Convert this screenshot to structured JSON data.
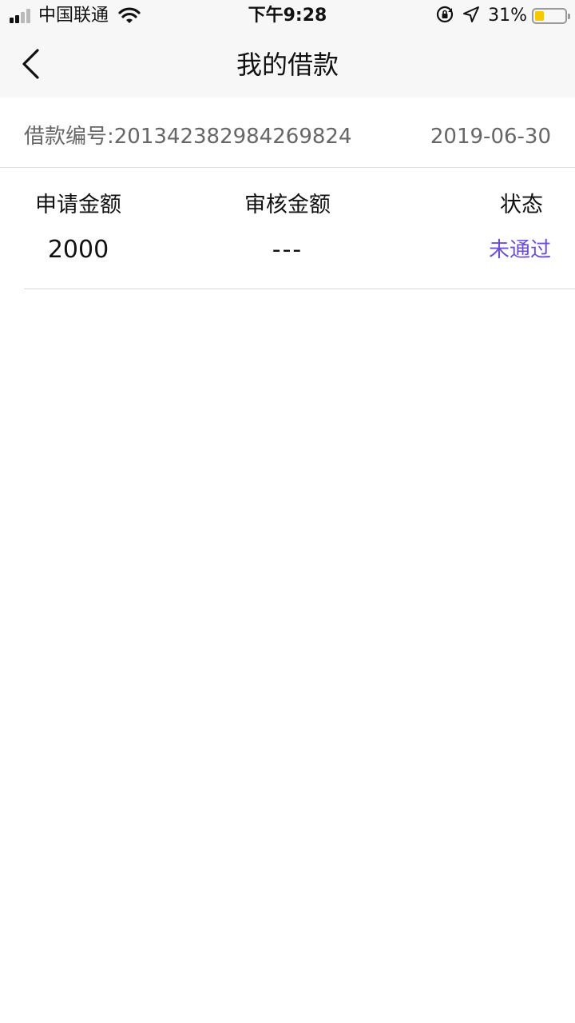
{
  "status_bar": {
    "carrier": "中国联通",
    "time": "下午9:28",
    "battery_percent": "31%",
    "battery_level": 0.31,
    "battery_color": "#f6c800",
    "icons": [
      "signal-icon",
      "wifi-icon",
      "rotation-lock-icon",
      "location-arrow-icon",
      "battery-icon"
    ]
  },
  "nav": {
    "title": "我的借款",
    "back_icon": "chevron-left-icon"
  },
  "loan": {
    "id_text": "借款编号:201342382984269824",
    "date": "2019-06-30",
    "columns": [
      {
        "label": "申请金额",
        "value": "2000"
      },
      {
        "label": "审核金额",
        "value": "---"
      },
      {
        "label": "状态",
        "value": "未通过"
      }
    ],
    "status_color": "#6b4fd8"
  }
}
